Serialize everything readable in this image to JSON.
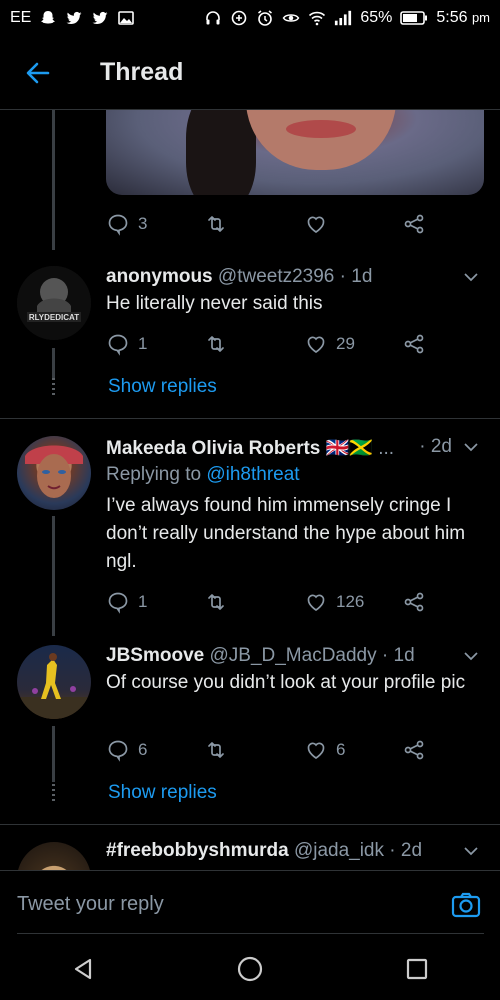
{
  "status_bar": {
    "carrier": "EE",
    "battery": "65%",
    "time": "5:56",
    "time_suffix": "pm"
  },
  "header": {
    "title": "Thread",
    "back_icon": "arrow-left-icon"
  },
  "colors": {
    "accent": "#1d9bf0",
    "background": "#000000",
    "muted": "#8b98a5",
    "text": "#e7e9ea",
    "divider": "#2f3336"
  },
  "top_tweet_actions": {
    "reply_count": "3"
  },
  "tweets": [
    {
      "name": "anonymous",
      "handle": "@tweetz2396",
      "time": "· 1d",
      "text": "He literally never said this",
      "reply_count": "1",
      "retweet_count": "",
      "like_count": "29",
      "show_replies": "Show replies",
      "avatar_text": "RLYDEDICAT"
    },
    {
      "name": "Makeeda Olivia Roberts",
      "name_suffix": "🇬🇧🇯🇲 ...",
      "handle": "",
      "time": "· 2d",
      "replying_prefix": "Replying to",
      "replying_handle": "@ih8threat",
      "text": "I’ve always found him immensely cringe I don’t really understand the hype about him ngl.",
      "reply_count": "1",
      "like_count": "126"
    },
    {
      "name": "JBSmoove",
      "handle": "@JB_D_MacDaddy",
      "time": "· 1d",
      "text": "Of course you didn’t look at your profile pic",
      "reply_count": "6",
      "like_count": "6",
      "show_replies": "Show replies"
    },
    {
      "name": "#freebobbyshmurda",
      "handle": "@jada_idk",
      "time": "· 2d"
    }
  ],
  "reply_bar": {
    "placeholder": "Tweet your reply",
    "camera_icon": "camera-icon"
  },
  "nav": {
    "back_icon": "triangle-back-icon",
    "home_icon": "circle-home-icon",
    "recents_icon": "square-recents-icon"
  }
}
